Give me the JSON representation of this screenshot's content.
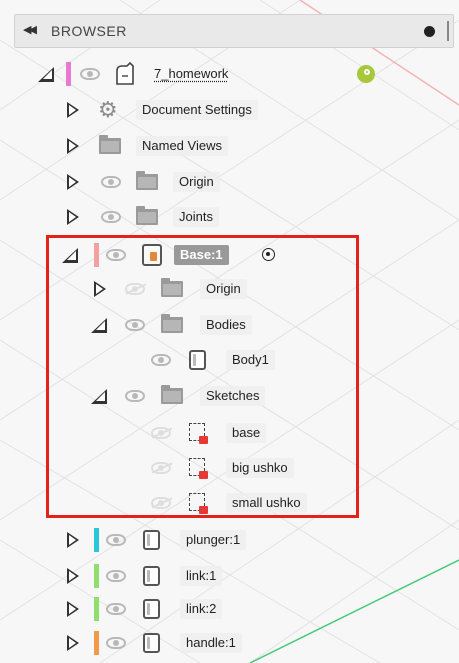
{
  "browser": {
    "title": "BROWSER",
    "collapse_glyph": "◀◀"
  },
  "tree": [
    {
      "key": "root",
      "label": "7_homework",
      "toggle": "expanded",
      "color": "#e879d0",
      "icon": "document-icon",
      "eye": "visible",
      "badge": true
    },
    {
      "key": "doc-settings",
      "label": "Document Settings",
      "toggle": "collapsed",
      "icon": "gear-icon",
      "eye": "none"
    },
    {
      "key": "named-views",
      "label": "Named Views",
      "toggle": "collapsed",
      "icon": "folder-icon",
      "eye": "none"
    },
    {
      "key": "origin",
      "label": "Origin",
      "toggle": "collapsed",
      "icon": "folder-icon",
      "eye": "visible"
    },
    {
      "key": "joints",
      "label": "Joints",
      "toggle": "collapsed",
      "icon": "folder-icon",
      "eye": "visible"
    },
    {
      "key": "base",
      "label": "Base:1",
      "toggle": "expanded",
      "color": "#f2a0a0",
      "icon": "component-icon",
      "eye": "visible",
      "active": true
    },
    {
      "key": "base-origin",
      "label": "Origin",
      "toggle": "collapsed",
      "icon": "folder-icon",
      "eye": "hidden"
    },
    {
      "key": "bodies",
      "label": "Bodies",
      "toggle": "expanded",
      "icon": "folder-icon",
      "eye": "visible"
    },
    {
      "key": "body1",
      "label": "Body1",
      "toggle": "none",
      "icon": "body-icon",
      "eye": "visible"
    },
    {
      "key": "sketches",
      "label": "Sketches",
      "toggle": "expanded",
      "icon": "folder-icon",
      "eye": "visible"
    },
    {
      "key": "sketch-base",
      "label": "base",
      "toggle": "none",
      "icon": "sketch-icon",
      "eye": "hidden"
    },
    {
      "key": "sketch-big",
      "label": "big ushko",
      "toggle": "none",
      "icon": "sketch-icon",
      "eye": "hidden"
    },
    {
      "key": "sketch-small",
      "label": "small ushko",
      "toggle": "none",
      "icon": "sketch-icon",
      "eye": "hidden"
    },
    {
      "key": "plunger",
      "label": "plunger:1",
      "toggle": "collapsed",
      "color": "#27c6d8",
      "icon": "body-icon",
      "eye": "visible"
    },
    {
      "key": "link1",
      "label": "link:1",
      "toggle": "collapsed",
      "color": "#8ee06a",
      "icon": "body-icon",
      "eye": "visible"
    },
    {
      "key": "link2",
      "label": "link:2",
      "toggle": "collapsed",
      "color": "#8ee06a",
      "icon": "body-icon",
      "eye": "visible"
    },
    {
      "key": "handle",
      "label": "handle:1",
      "toggle": "collapsed",
      "color": "#f39a4a",
      "icon": "body-icon",
      "eye": "visible"
    }
  ],
  "colors": {
    "highlight": "#e2231a",
    "active_label_bg": "#999999",
    "badge": "#a7c83a"
  }
}
